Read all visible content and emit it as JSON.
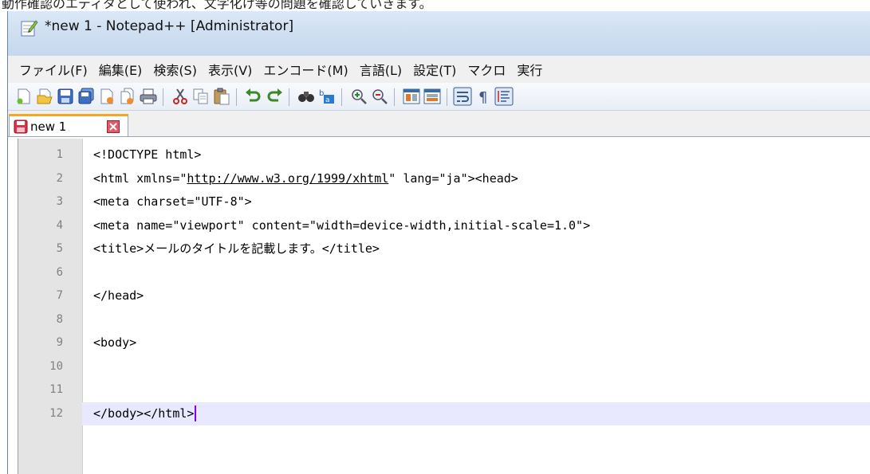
{
  "window": {
    "title": "*new 1 - Notepad++ [Administrator]"
  },
  "top_fragment": "動作確認のエディタとして使われ、文字化け等の問題を確認していきます。",
  "menu": {
    "items": [
      "ファイル(F)",
      "編集(E)",
      "検索(S)",
      "表示(V)",
      "エンコード(M)",
      "言語(L)",
      "設定(T)",
      "マクロ",
      "実行"
    ]
  },
  "toolbar": {
    "buttons": [
      "new-file-icon",
      "open-file-icon",
      "save-icon",
      "save-all-icon",
      "close-icon",
      "close-all-icon",
      "print-icon",
      "cut-icon",
      "copy-icon",
      "paste-icon",
      "undo-icon",
      "redo-icon",
      "find-icon",
      "replace-icon",
      "zoom-in-icon",
      "zoom-out-icon",
      "sync-vertical-icon",
      "sync-horizontal-icon",
      "word-wrap-icon",
      "show-all-chars-icon",
      "indent-guide-icon"
    ]
  },
  "tab": {
    "label": "new 1"
  },
  "editor": {
    "lines": [
      {
        "num": "1",
        "pre": "<!DOCTYPE html>",
        "link": "",
        "post": ""
      },
      {
        "num": "2",
        "pre": "<html xmlns=\"",
        "link": "http://www.w3.org/1999/xhtml",
        "post": "\" lang=\"ja\"><head>"
      },
      {
        "num": "3",
        "pre": "<meta charset=\"UTF-8\">",
        "link": "",
        "post": ""
      },
      {
        "num": "4",
        "pre": "<meta name=\"viewport\" content=\"width=device-width,initial-scale=1.0\">",
        "link": "",
        "post": ""
      },
      {
        "num": "5",
        "pre": "<title>メールのタイトルを記載します。</title>",
        "link": "",
        "post": ""
      },
      {
        "num": "6",
        "pre": "",
        "link": "",
        "post": ""
      },
      {
        "num": "7",
        "pre": "</head>",
        "link": "",
        "post": ""
      },
      {
        "num": "8",
        "pre": "",
        "link": "",
        "post": ""
      },
      {
        "num": "9",
        "pre": "<body>",
        "link": "",
        "post": ""
      },
      {
        "num": "10",
        "pre": "",
        "link": "",
        "post": ""
      },
      {
        "num": "11",
        "pre": "",
        "link": "",
        "post": ""
      },
      {
        "num": "12",
        "pre": "</body></html>",
        "link": "",
        "post": ""
      }
    ],
    "current_line": "12"
  },
  "colors": {
    "tab_accent": "#f5a623",
    "current_line_bg": "#e8e8ff",
    "caret": "#8000ff",
    "gutter_bg": "#e4e4e4"
  }
}
